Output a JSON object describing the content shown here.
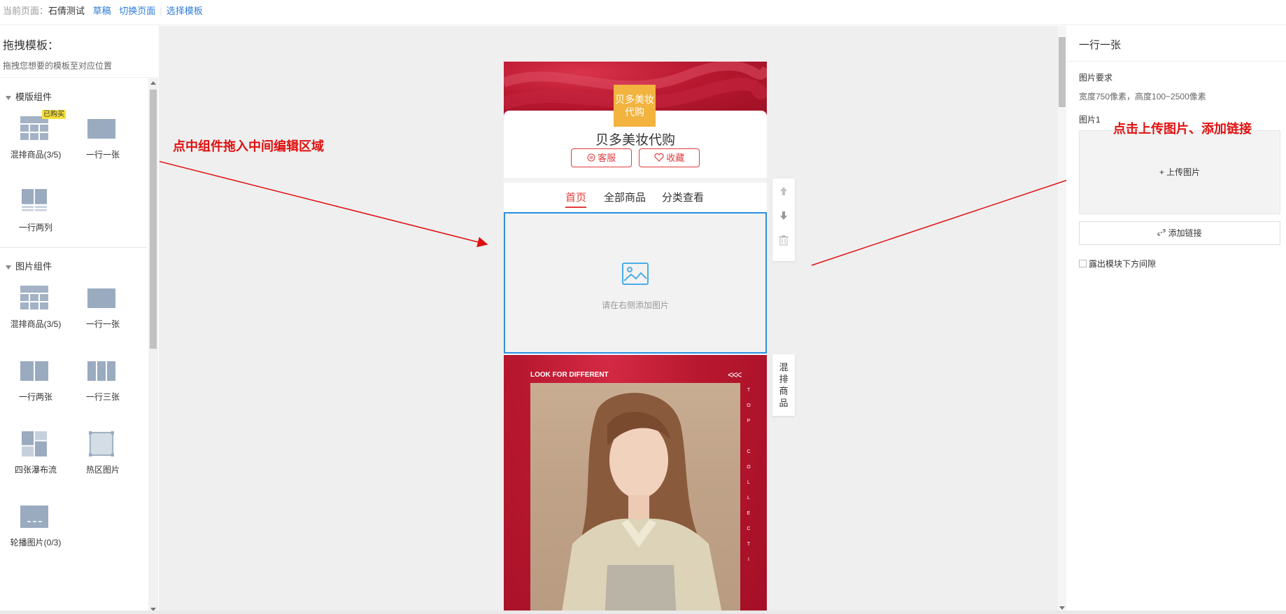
{
  "topbar": {
    "current_page_label": "当前页面：",
    "page_name": "石倩测试",
    "draft": "草稿",
    "switch_page": "切换页面",
    "choose_template": "选择模板"
  },
  "left": {
    "title": "拖拽模板：",
    "subtitle": "拖拽您想要的模板至对应位置",
    "sections": [
      {
        "title": "模版组件",
        "items": [
          {
            "label": "混排商品(3/5)",
            "icon": "mixed-goods-icon",
            "badge": "已购买"
          },
          {
            "label": "一行一张",
            "icon": "one-image-icon"
          },
          {
            "label": "一行两列",
            "icon": "two-column-icon"
          }
        ]
      },
      {
        "title": "图片组件",
        "items": [
          {
            "label": "混排商品(3/5)",
            "icon": "mixed-goods-icon"
          },
          {
            "label": "一行一张",
            "icon": "one-image-icon"
          },
          {
            "label": "一行两张",
            "icon": "two-images-icon"
          },
          {
            "label": "一行三张",
            "icon": "three-images-icon"
          },
          {
            "label": "四张瀑布流",
            "icon": "waterfall-icon"
          },
          {
            "label": "热区图片",
            "icon": "hotspot-icon"
          },
          {
            "label": "轮播图片(0/3)",
            "icon": "carousel-icon"
          }
        ]
      }
    ]
  },
  "phone": {
    "logo_text": "贝多美妆代购",
    "store_name": "贝多美妆代购",
    "service_btn": "客服",
    "favorite_btn": "收藏",
    "tabs": [
      "首页",
      "全部商品",
      "分类查看"
    ],
    "active_tab": "首页",
    "placeholder": "请在右侧添加图片",
    "promo_heading": "LOOK FOR DIFFERENT",
    "promo_chevrons": "<<<",
    "promo_vertical": [
      "T",
      "O",
      "P",
      "C",
      "O",
      "L",
      "L",
      "E",
      "C",
      "T",
      "I"
    ],
    "side_label": "混排商品"
  },
  "annotations": {
    "drag_hint": "点中组件拖入中间编辑区域",
    "upload_hint": "点击上传图片、添加链接"
  },
  "right": {
    "title": "一行一张",
    "requirement_label": "图片要求",
    "requirement_desc": "宽度750像素，高度100~2500像素",
    "image_label": "图片1",
    "upload_btn": "+ 上传图片",
    "add_link_btn": "添加链接",
    "show_gap": "露出模块下方间隙"
  },
  "colors": {
    "accent_red": "#e03c3c",
    "selection_blue": "#2d8fe0",
    "link_blue": "#2f7bd9",
    "annotation_red": "#e01010",
    "logo_orange": "#f2b33f"
  }
}
